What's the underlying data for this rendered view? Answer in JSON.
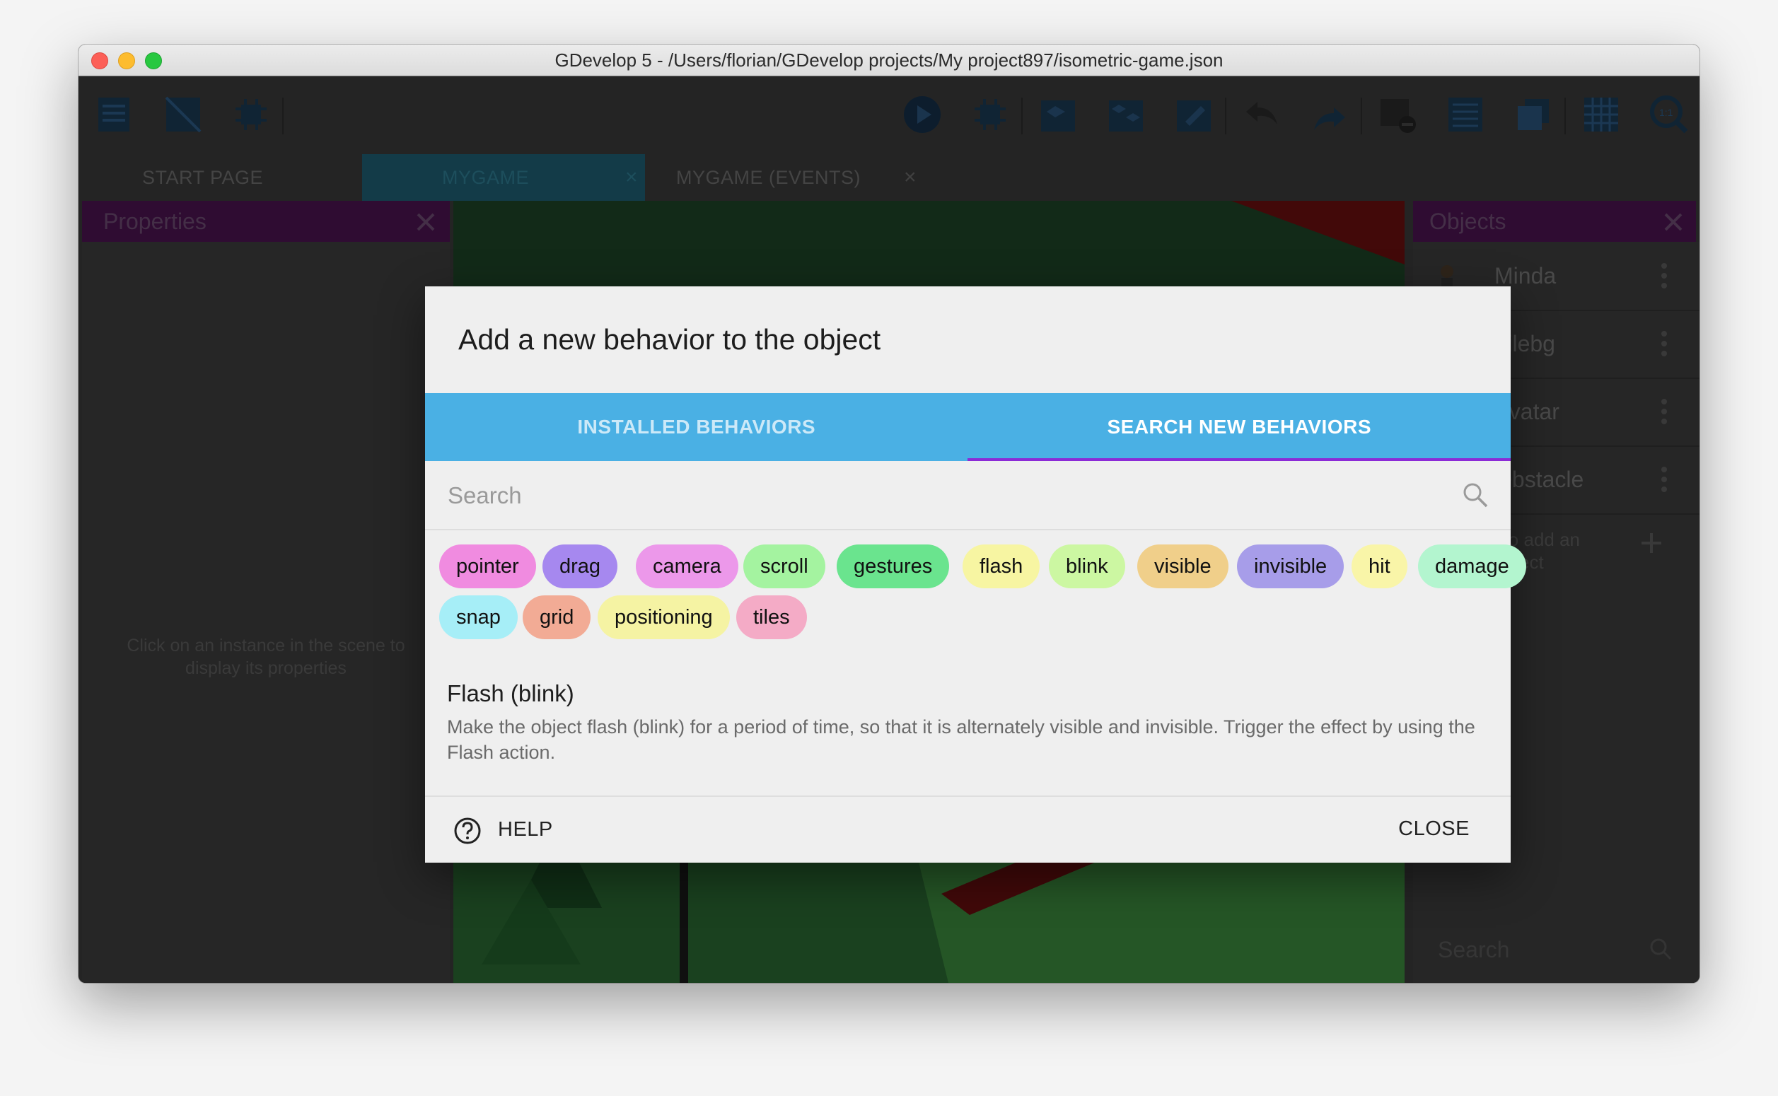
{
  "window": {
    "title": "GDevelop 5 - /Users/florian/GDevelop projects/My project897/isometric-game.json"
  },
  "tabs": [
    {
      "label": "START PAGE",
      "active": false,
      "closable": false
    },
    {
      "label": "MYGAME",
      "active": true,
      "closable": true
    },
    {
      "label": "MYGAME (EVENTS)",
      "active": false,
      "closable": true
    }
  ],
  "properties_panel": {
    "title": "Properties",
    "hint": "Click on an instance in the scene to display its properties"
  },
  "objects_panel": {
    "title": "Objects",
    "items": [
      {
        "name": "Minda",
        "icon": "character-thumbnail"
      },
      {
        "name": "Tilebg",
        "icon": "tile-thumbnail"
      },
      {
        "name": "Avatar",
        "icon": "avatar-thumbnail"
      },
      {
        "name": "Obstacle",
        "icon": "obstacle-thumbnail"
      }
    ],
    "add_hint": "Click to add an object",
    "search_placeholder": "Search"
  },
  "dialog": {
    "title": "Add a new behavior to the object",
    "tabs": [
      {
        "label": "INSTALLED BEHAVIORS",
        "active": false
      },
      {
        "label": "SEARCH NEW BEHAVIORS",
        "active": true
      }
    ],
    "search": {
      "placeholder": "Search",
      "value": ""
    },
    "tags": [
      {
        "label": "pointer",
        "color": "#f08be0"
      },
      {
        "label": "drag",
        "color": "#a688ef"
      },
      {
        "label": "camera",
        "color": "#ec98ea"
      },
      {
        "label": "scroll",
        "color": "#a4f3a0"
      },
      {
        "label": "gestures",
        "color": "#6ae48e"
      },
      {
        "label": "flash",
        "color": "#f7f5a2"
      },
      {
        "label": "blink",
        "color": "#ccf7a2"
      },
      {
        "label": "visible",
        "color": "#f0cf8a"
      },
      {
        "label": "invisible",
        "color": "#a79de9"
      },
      {
        "label": "hit",
        "color": "#f9f5a8"
      },
      {
        "label": "damage",
        "color": "#b3f5cf"
      },
      {
        "label": "snap",
        "color": "#a6eef7"
      },
      {
        "label": "grid",
        "color": "#f2ab95"
      },
      {
        "label": "positioning",
        "color": "#f5f3a3"
      },
      {
        "label": "tiles",
        "color": "#f4abc6"
      }
    ],
    "behavior": {
      "name": "Flash (blink)",
      "description": "Make the object flash (blink) for a period of time, so that it is alternately visible and invisible. Trigger the effect by using the Flash action."
    },
    "help_label": "HELP",
    "close_label": "CLOSE"
  },
  "colors": {
    "dialog_tab_bar": "#4ab0e4",
    "tab_indicator": "#8b2bd6",
    "panel_header": "#4c1452"
  }
}
